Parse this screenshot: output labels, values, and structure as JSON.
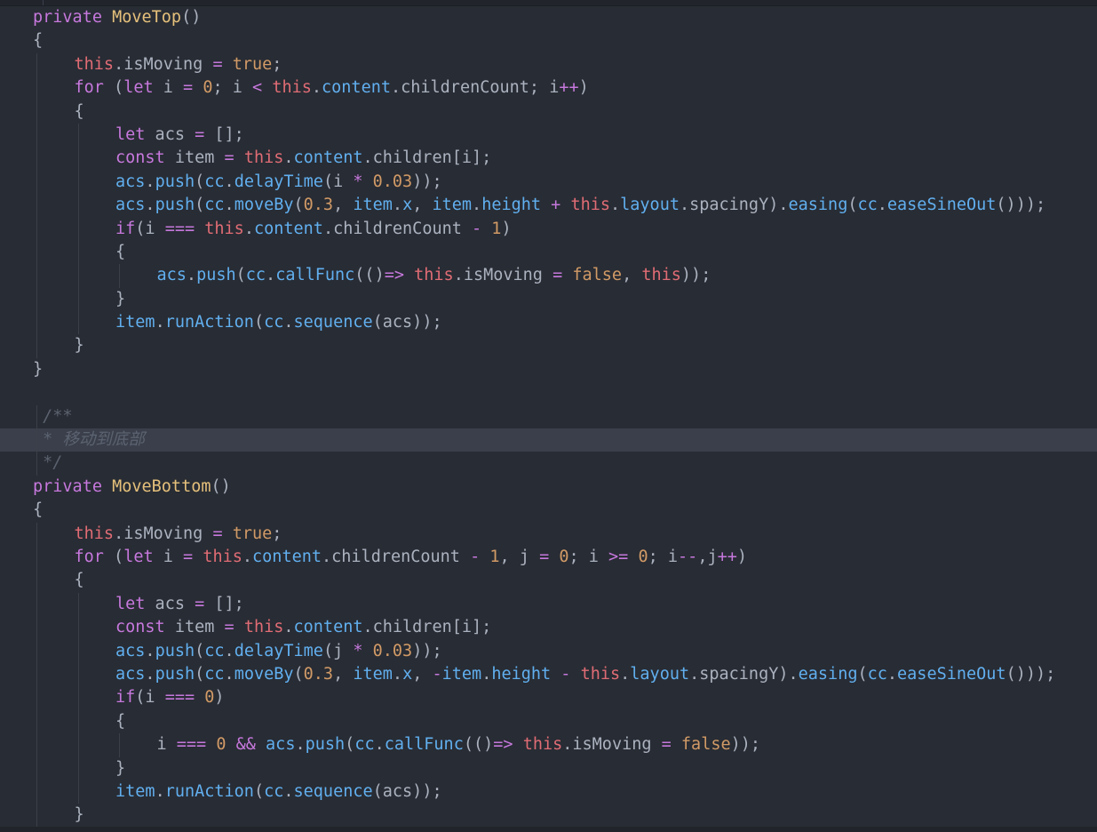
{
  "editor": {
    "language": "TypeScript",
    "colors": {
      "background": "#282c34",
      "keyword": "#c678dd",
      "function": "#e5c07b",
      "this": "#e06c75",
      "property": "#61afef",
      "number": "#d19a66",
      "comment": "#5c6370",
      "plain": "#abb2bf",
      "line_highlight": "#3a3f4b"
    },
    "lines": [
      {
        "indent": 0,
        "tokens": [
          [
            "kw",
            "private"
          ],
          [
            "pl",
            " "
          ],
          [
            "fn",
            "MoveTop"
          ],
          [
            "pl",
            "()"
          ]
        ]
      },
      {
        "indent": 0,
        "tokens": [
          [
            "pl",
            "{"
          ]
        ]
      },
      {
        "indent": 1,
        "tokens": [
          [
            "this",
            "this"
          ],
          [
            "pl",
            ".isMoving "
          ],
          [
            "op",
            "="
          ],
          [
            "pl",
            " "
          ],
          [
            "bool",
            "true"
          ],
          [
            "pl",
            ";"
          ]
        ]
      },
      {
        "indent": 1,
        "tokens": [
          [
            "kw",
            "for"
          ],
          [
            "pl",
            " ("
          ],
          [
            "kw",
            "let"
          ],
          [
            "pl",
            " i "
          ],
          [
            "op",
            "="
          ],
          [
            "pl",
            " "
          ],
          [
            "num",
            "0"
          ],
          [
            "pl",
            "; i "
          ],
          [
            "op",
            "<"
          ],
          [
            "pl",
            " "
          ],
          [
            "this",
            "this"
          ],
          [
            "pl",
            "."
          ],
          [
            "prop",
            "content"
          ],
          [
            "pl",
            ".childrenCount; i"
          ],
          [
            "op",
            "++"
          ],
          [
            "pl",
            ")"
          ]
        ]
      },
      {
        "indent": 1,
        "tokens": [
          [
            "pl",
            "{"
          ]
        ]
      },
      {
        "indent": 2,
        "tokens": [
          [
            "kw",
            "let"
          ],
          [
            "pl",
            " acs "
          ],
          [
            "op",
            "="
          ],
          [
            "pl",
            " [];"
          ]
        ]
      },
      {
        "indent": 2,
        "tokens": [
          [
            "kw",
            "const"
          ],
          [
            "pl",
            " item "
          ],
          [
            "op",
            "="
          ],
          [
            "pl",
            " "
          ],
          [
            "this",
            "this"
          ],
          [
            "pl",
            "."
          ],
          [
            "prop",
            "content"
          ],
          [
            "pl",
            ".children[i];"
          ]
        ]
      },
      {
        "indent": 2,
        "tokens": [
          [
            "prop",
            "acs"
          ],
          [
            "pl",
            "."
          ],
          [
            "prop",
            "push"
          ],
          [
            "pl",
            "("
          ],
          [
            "prop",
            "cc"
          ],
          [
            "pl",
            "."
          ],
          [
            "prop",
            "delayTime"
          ],
          [
            "pl",
            "(i "
          ],
          [
            "op",
            "*"
          ],
          [
            "pl",
            " "
          ],
          [
            "num",
            "0.03"
          ],
          [
            "pl",
            "));"
          ]
        ]
      },
      {
        "indent": 2,
        "tokens": [
          [
            "prop",
            "acs"
          ],
          [
            "pl",
            "."
          ],
          [
            "prop",
            "push"
          ],
          [
            "pl",
            "("
          ],
          [
            "prop",
            "cc"
          ],
          [
            "pl",
            "."
          ],
          [
            "prop",
            "moveBy"
          ],
          [
            "pl",
            "("
          ],
          [
            "num",
            "0.3"
          ],
          [
            "pl",
            ", "
          ],
          [
            "prop",
            "item"
          ],
          [
            "pl",
            "."
          ],
          [
            "prop",
            "x"
          ],
          [
            "pl",
            ", "
          ],
          [
            "prop",
            "item"
          ],
          [
            "pl",
            "."
          ],
          [
            "prop",
            "height"
          ],
          [
            "pl",
            " "
          ],
          [
            "op",
            "+"
          ],
          [
            "pl",
            " "
          ],
          [
            "this",
            "this"
          ],
          [
            "pl",
            "."
          ],
          [
            "prop",
            "layout"
          ],
          [
            "pl",
            ".spacingY)."
          ],
          [
            "prop",
            "easing"
          ],
          [
            "pl",
            "("
          ],
          [
            "prop",
            "cc"
          ],
          [
            "pl",
            "."
          ],
          [
            "prop",
            "easeSineOut"
          ],
          [
            "pl",
            "()));"
          ]
        ]
      },
      {
        "indent": 2,
        "tokens": [
          [
            "kw",
            "if"
          ],
          [
            "pl",
            "(i "
          ],
          [
            "op",
            "==="
          ],
          [
            "pl",
            " "
          ],
          [
            "this",
            "this"
          ],
          [
            "pl",
            "."
          ],
          [
            "prop",
            "content"
          ],
          [
            "pl",
            ".childrenCount "
          ],
          [
            "op",
            "-"
          ],
          [
            "pl",
            " "
          ],
          [
            "num",
            "1"
          ],
          [
            "pl",
            ")"
          ]
        ]
      },
      {
        "indent": 2,
        "tokens": [
          [
            "pl",
            "{"
          ]
        ]
      },
      {
        "indent": 3,
        "tokens": [
          [
            "prop",
            "acs"
          ],
          [
            "pl",
            "."
          ],
          [
            "prop",
            "push"
          ],
          [
            "pl",
            "("
          ],
          [
            "prop",
            "cc"
          ],
          [
            "pl",
            "."
          ],
          [
            "prop",
            "callFunc"
          ],
          [
            "pl",
            "(()"
          ],
          [
            "op",
            "=>"
          ],
          [
            "pl",
            " "
          ],
          [
            "this",
            "this"
          ],
          [
            "pl",
            ".isMoving "
          ],
          [
            "op",
            "="
          ],
          [
            "pl",
            " "
          ],
          [
            "bool",
            "false"
          ],
          [
            "pl",
            ", "
          ],
          [
            "this",
            "this"
          ],
          [
            "pl",
            "));"
          ]
        ]
      },
      {
        "indent": 2,
        "tokens": [
          [
            "pl",
            "}"
          ]
        ]
      },
      {
        "indent": 2,
        "tokens": [
          [
            "prop",
            "item"
          ],
          [
            "pl",
            "."
          ],
          [
            "prop",
            "runAction"
          ],
          [
            "pl",
            "("
          ],
          [
            "prop",
            "cc"
          ],
          [
            "pl",
            "."
          ],
          [
            "prop",
            "sequence"
          ],
          [
            "pl",
            "(acs));"
          ]
        ]
      },
      {
        "indent": 1,
        "tokens": [
          [
            "pl",
            "}"
          ]
        ]
      },
      {
        "indent": 0,
        "tokens": [
          [
            "pl",
            "}"
          ]
        ]
      },
      {
        "indent": 0,
        "tokens": []
      },
      {
        "indent": 0,
        "tokens": [
          [
            "cm",
            " /**"
          ]
        ]
      },
      {
        "indent": 0,
        "highlight": true,
        "tokens": [
          [
            "cm",
            " * 移动到底部"
          ]
        ]
      },
      {
        "indent": 0,
        "tokens": [
          [
            "cm",
            " */"
          ]
        ]
      },
      {
        "indent": 0,
        "tokens": [
          [
            "kw",
            "private"
          ],
          [
            "pl",
            " "
          ],
          [
            "fn",
            "MoveBottom"
          ],
          [
            "pl",
            "()"
          ]
        ]
      },
      {
        "indent": 0,
        "tokens": [
          [
            "pl",
            "{"
          ]
        ]
      },
      {
        "indent": 1,
        "tokens": [
          [
            "this",
            "this"
          ],
          [
            "pl",
            ".isMoving "
          ],
          [
            "op",
            "="
          ],
          [
            "pl",
            " "
          ],
          [
            "bool",
            "true"
          ],
          [
            "pl",
            ";"
          ]
        ]
      },
      {
        "indent": 1,
        "tokens": [
          [
            "kw",
            "for"
          ],
          [
            "pl",
            " ("
          ],
          [
            "kw",
            "let"
          ],
          [
            "pl",
            " i "
          ],
          [
            "op",
            "="
          ],
          [
            "pl",
            " "
          ],
          [
            "this",
            "this"
          ],
          [
            "pl",
            "."
          ],
          [
            "prop",
            "content"
          ],
          [
            "pl",
            ".childrenCount "
          ],
          [
            "op",
            "-"
          ],
          [
            "pl",
            " "
          ],
          [
            "num",
            "1"
          ],
          [
            "pl",
            ", j "
          ],
          [
            "op",
            "="
          ],
          [
            "pl",
            " "
          ],
          [
            "num",
            "0"
          ],
          [
            "pl",
            "; i "
          ],
          [
            "op",
            ">="
          ],
          [
            "pl",
            " "
          ],
          [
            "num",
            "0"
          ],
          [
            "pl",
            "; i"
          ],
          [
            "op",
            "--"
          ],
          [
            "pl",
            ",j"
          ],
          [
            "op",
            "++"
          ],
          [
            "pl",
            ")"
          ]
        ]
      },
      {
        "indent": 1,
        "tokens": [
          [
            "pl",
            "{"
          ]
        ]
      },
      {
        "indent": 2,
        "tokens": [
          [
            "kw",
            "let"
          ],
          [
            "pl",
            " acs "
          ],
          [
            "op",
            "="
          ],
          [
            "pl",
            " [];"
          ]
        ]
      },
      {
        "indent": 2,
        "tokens": [
          [
            "kw",
            "const"
          ],
          [
            "pl",
            " item "
          ],
          [
            "op",
            "="
          ],
          [
            "pl",
            " "
          ],
          [
            "this",
            "this"
          ],
          [
            "pl",
            "."
          ],
          [
            "prop",
            "content"
          ],
          [
            "pl",
            ".children[i];"
          ]
        ]
      },
      {
        "indent": 2,
        "tokens": [
          [
            "prop",
            "acs"
          ],
          [
            "pl",
            "."
          ],
          [
            "prop",
            "push"
          ],
          [
            "pl",
            "("
          ],
          [
            "prop",
            "cc"
          ],
          [
            "pl",
            "."
          ],
          [
            "prop",
            "delayTime"
          ],
          [
            "pl",
            "(j "
          ],
          [
            "op",
            "*"
          ],
          [
            "pl",
            " "
          ],
          [
            "num",
            "0.03"
          ],
          [
            "pl",
            "));"
          ]
        ]
      },
      {
        "indent": 2,
        "tokens": [
          [
            "prop",
            "acs"
          ],
          [
            "pl",
            "."
          ],
          [
            "prop",
            "push"
          ],
          [
            "pl",
            "("
          ],
          [
            "prop",
            "cc"
          ],
          [
            "pl",
            "."
          ],
          [
            "prop",
            "moveBy"
          ],
          [
            "pl",
            "("
          ],
          [
            "num",
            "0.3"
          ],
          [
            "pl",
            ", "
          ],
          [
            "prop",
            "item"
          ],
          [
            "pl",
            "."
          ],
          [
            "prop",
            "x"
          ],
          [
            "pl",
            ", "
          ],
          [
            "op",
            "-"
          ],
          [
            "prop",
            "item"
          ],
          [
            "pl",
            "."
          ],
          [
            "prop",
            "height"
          ],
          [
            "pl",
            " "
          ],
          [
            "op",
            "-"
          ],
          [
            "pl",
            " "
          ],
          [
            "this",
            "this"
          ],
          [
            "pl",
            "."
          ],
          [
            "prop",
            "layout"
          ],
          [
            "pl",
            ".spacingY)."
          ],
          [
            "prop",
            "easing"
          ],
          [
            "pl",
            "("
          ],
          [
            "prop",
            "cc"
          ],
          [
            "pl",
            "."
          ],
          [
            "prop",
            "easeSineOut"
          ],
          [
            "pl",
            "()));"
          ]
        ]
      },
      {
        "indent": 2,
        "tokens": [
          [
            "kw",
            "if"
          ],
          [
            "pl",
            "(i "
          ],
          [
            "op",
            "==="
          ],
          [
            "pl",
            " "
          ],
          [
            "num",
            "0"
          ],
          [
            "pl",
            ")"
          ]
        ]
      },
      {
        "indent": 2,
        "tokens": [
          [
            "pl",
            "{"
          ]
        ]
      },
      {
        "indent": 3,
        "tokens": [
          [
            "pl",
            "i "
          ],
          [
            "op",
            "==="
          ],
          [
            "pl",
            " "
          ],
          [
            "num",
            "0"
          ],
          [
            "pl",
            " "
          ],
          [
            "op",
            "&&"
          ],
          [
            "pl",
            " "
          ],
          [
            "prop",
            "acs"
          ],
          [
            "pl",
            "."
          ],
          [
            "prop",
            "push"
          ],
          [
            "pl",
            "("
          ],
          [
            "prop",
            "cc"
          ],
          [
            "pl",
            "."
          ],
          [
            "prop",
            "callFunc"
          ],
          [
            "pl",
            "(()"
          ],
          [
            "op",
            "=>"
          ],
          [
            "pl",
            " "
          ],
          [
            "this",
            "this"
          ],
          [
            "pl",
            ".isMoving "
          ],
          [
            "op",
            "="
          ],
          [
            "pl",
            " "
          ],
          [
            "bool",
            "false"
          ],
          [
            "pl",
            "));"
          ]
        ]
      },
      {
        "indent": 2,
        "tokens": [
          [
            "pl",
            "}"
          ]
        ]
      },
      {
        "indent": 2,
        "tokens": [
          [
            "prop",
            "item"
          ],
          [
            "pl",
            "."
          ],
          [
            "prop",
            "runAction"
          ],
          [
            "pl",
            "("
          ],
          [
            "prop",
            "cc"
          ],
          [
            "pl",
            "."
          ],
          [
            "prop",
            "sequence"
          ],
          [
            "pl",
            "(acs));"
          ]
        ]
      },
      {
        "indent": 1,
        "tokens": [
          [
            "pl",
            "}"
          ]
        ]
      }
    ]
  }
}
